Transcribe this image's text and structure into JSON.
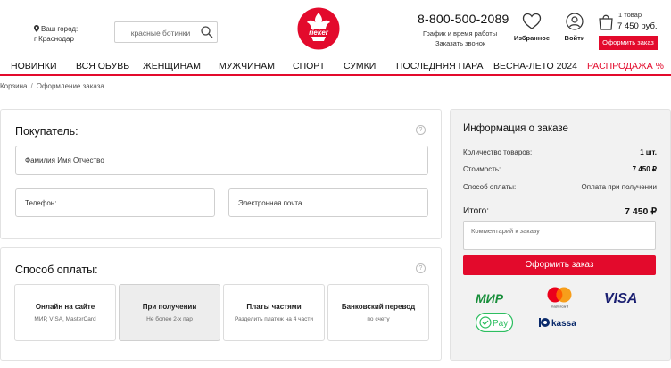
{
  "header": {
    "city_label": "Ваш город:",
    "city_name": "г Краснодар",
    "search_placeholder": "красные ботинки",
    "logo_text": "rieker",
    "phone": "8-800-500-2089",
    "schedule": "График и время работы",
    "callback": "Заказать звонок",
    "favorites": "Избранное",
    "login": "Войти",
    "cart_count": "1 товар",
    "cart_sum": "7 450 руб.",
    "checkout": "Оформить заказ"
  },
  "nav": [
    {
      "label": "Новинки"
    },
    {
      "label": "Вся обувь"
    },
    {
      "label": "Женщинам"
    },
    {
      "label": "Мужчинам"
    },
    {
      "label": "Спорт"
    },
    {
      "label": "Сумки"
    },
    {
      "label": "Последняя пара"
    },
    {
      "label": "Весна-лето 2024"
    },
    {
      "label": "Распродажа %"
    }
  ],
  "breadcrumb": {
    "items": [
      "Корзина",
      "Оформление заказа"
    ]
  },
  "buyer": {
    "title": "Покупатель:",
    "name_placeholder": "Фамилия Имя Отчество",
    "phone_placeholder": "Телефон:",
    "email_placeholder": "Электронная почта"
  },
  "payment": {
    "title": "Способ оплаты:",
    "options": [
      {
        "title": "Онлайн на сайте",
        "subtitle": "МИР, VISA, MasterCard"
      },
      {
        "title": "При получении",
        "subtitle": "Не более 2-х пар"
      },
      {
        "title": "Платы частями",
        "subtitle": "Разделить платеж на 4 части"
      },
      {
        "title": "Банковский перевод",
        "subtitle": "по счету"
      }
    ]
  },
  "order": {
    "title": "Информация о заказе",
    "rows": [
      {
        "label": "Количество товаров:",
        "value": "1 шт."
      },
      {
        "label": "Стоимость:",
        "value": "7 450 ₽"
      },
      {
        "label": "Способ оплаты:",
        "value": "Оплата при получении"
      }
    ],
    "total_label": "Итого:",
    "total_value": "7 450 ₽",
    "comment_placeholder": "Комментарий к заказу",
    "checkout": "Оформить заказ",
    "logos": {
      "mir": "МИР",
      "mastercard": "mastercard",
      "visa": "VISA",
      "gpay": "Pay",
      "ykassa": "kassa"
    }
  },
  "colors": {
    "accent": "#e30a2c"
  }
}
